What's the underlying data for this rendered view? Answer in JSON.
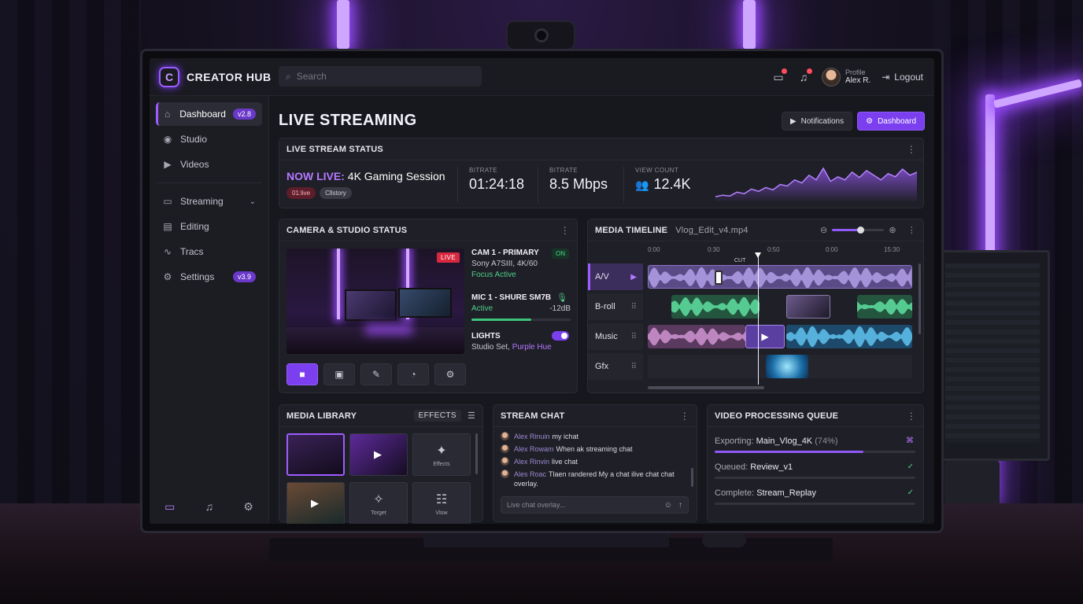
{
  "app": {
    "brand": "CREATOR HUB",
    "logo_letter": "C",
    "accent": "#9d5cff"
  },
  "search": {
    "placeholder": "Search",
    "icon": "search-icon"
  },
  "topbar": {
    "profile_label": "Profile",
    "profile_name": "Alex R.",
    "logout_label": "Logout",
    "icons": [
      "chat-icon",
      "bell-icon",
      "logout-icon"
    ]
  },
  "sidebar": {
    "items": [
      {
        "label": "Dashboard",
        "icon": "home-icon",
        "badge": "v2.8",
        "active": true
      },
      {
        "label": "Studio",
        "icon": "broadcast-icon"
      },
      {
        "label": "Videos",
        "icon": "video-icon"
      },
      {
        "label": "Streaming",
        "icon": "monitor-icon",
        "expandable": true
      },
      {
        "label": "Editing",
        "icon": "film-icon"
      },
      {
        "label": "Tracs",
        "icon": "pulse-icon"
      },
      {
        "label": "Settings",
        "icon": "gear-icon",
        "badge": "v3.9"
      }
    ],
    "bottom_icons": [
      "chat-icon",
      "bell-icon",
      "gear-icon"
    ]
  },
  "page": {
    "title": "LIVE STREAMING",
    "btn_notifications": "Notifications",
    "btn_dashboard": "Dashboard"
  },
  "live_status": {
    "header": "LIVE STREAM STATUS",
    "now_prefix": "NOW LIVE:",
    "now_title": "4K Gaming Session",
    "chip1": "01:live",
    "chip2": "Cllstory",
    "stats": [
      {
        "label": "BITRATE",
        "value": "01:24:18"
      },
      {
        "label": "BITRATE",
        "value": "8.5 Mbps"
      },
      {
        "label": "VIEW COUNT",
        "value": "12.4K"
      }
    ],
    "sparkline": [
      8,
      10,
      9,
      14,
      12,
      18,
      15,
      20,
      17,
      24,
      22,
      30,
      26,
      36,
      30,
      45,
      28,
      34,
      30,
      40,
      33,
      42,
      36,
      30,
      38,
      34,
      44,
      36,
      40
    ]
  },
  "camera": {
    "header": "CAMERA & STUDIO STATUS",
    "live_tag": "LIVE",
    "cam_title": "CAM 1 - PRIMARY",
    "cam_status_pill": "ON",
    "cam_model": "Sony A7SIII,  4K/60",
    "cam_focus": "Focus Active",
    "mic_title": "MIC 1 - SHURE SM7B",
    "mic_state": "Active",
    "mic_level_text": "-12dB",
    "mic_level": 0.6,
    "lights_title": "LIGHTS",
    "lights_scene": "Studio Set,",
    "lights_hue": "Purple Hue",
    "lights_on": true,
    "tools": [
      "camera-icon",
      "screen-icon",
      "pen-icon",
      "gauge-icon",
      "gear-icon"
    ]
  },
  "timeline": {
    "header": "MEDIA TIMELINE",
    "file": "Vlog_Edit_v4.mp4",
    "zoom_level": 0.55,
    "ruler": [
      "0:00",
      "0:30",
      "0:50",
      "0:00",
      "15:30"
    ],
    "cut_label": "CUT",
    "tracks": [
      {
        "label": "A/V",
        "selected": true
      },
      {
        "label": "B-roll"
      },
      {
        "label": "Music"
      },
      {
        "label": "Gfx"
      }
    ]
  },
  "library": {
    "header": "MEDIA LIBRARY",
    "effects_btn": "EFFECTS",
    "thumbs": [
      {
        "caption": ""
      },
      {
        "caption": ""
      },
      {
        "caption": "Effects",
        "icon": "sparkle-icon"
      },
      {
        "caption": ""
      },
      {
        "caption": "Torget",
        "icon": "magic-wand-icon"
      },
      {
        "caption": "Vlow",
        "icon": "sliders-icon"
      }
    ]
  },
  "chat": {
    "header": "STREAM CHAT",
    "messages": [
      {
        "user": "Alex Rinuin",
        "text": "my ichat"
      },
      {
        "user": "Alex Rowam",
        "text": "When ak streaming chat"
      },
      {
        "user": "Alex Rinvin",
        "text": "live chat"
      },
      {
        "user": "Ales Roac",
        "text": "Tlaen randered My a chat ilive chat chat overlay."
      }
    ],
    "input_placeholder": "Live chat overlay..."
  },
  "queue": {
    "header": "VIDEO PROCESSING QUEUE",
    "items": [
      {
        "prefix": "Exporting:",
        "name": "Main_Vlog_4K",
        "pct": "(74%)",
        "progress": 0.74,
        "state": "exporting"
      },
      {
        "prefix": "Queued:",
        "name": "Review_v1",
        "progress": 0,
        "state": "done"
      },
      {
        "prefix": "Complete:",
        "name": "Stream_Replay",
        "progress": 0,
        "state": "done"
      }
    ]
  }
}
